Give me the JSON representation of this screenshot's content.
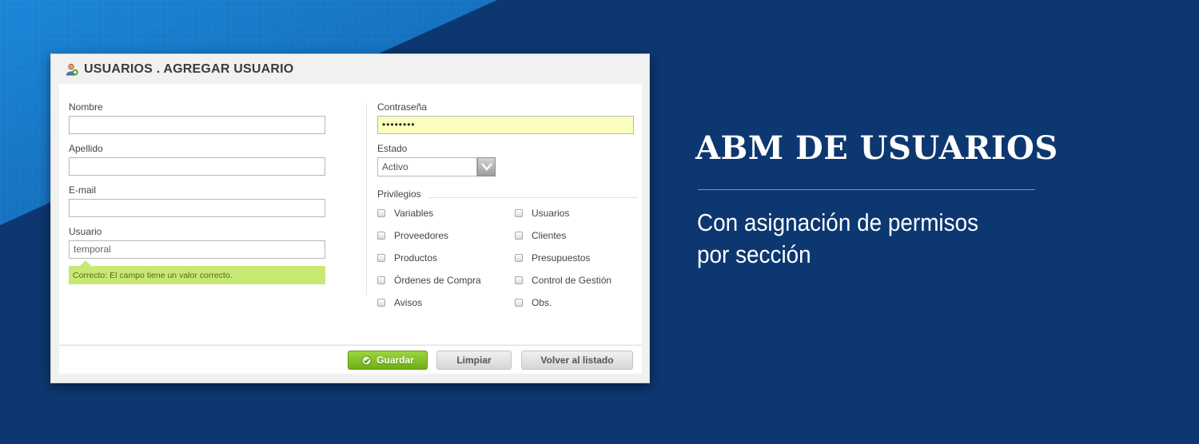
{
  "colors": {
    "background_dark": "#0d3770",
    "background_light": "#1575c8",
    "save_button": "#8cc63f",
    "valid_message": "#c8e874",
    "password_fill": "#fbffbe"
  },
  "panel": {
    "title": "USUARIOS . AGREGAR USUARIO",
    "title_icon": "user-add-icon",
    "fields": {
      "nombre": {
        "label": "Nombre",
        "value": ""
      },
      "apellido": {
        "label": "Apellido",
        "value": ""
      },
      "email": {
        "label": "E-mail",
        "value": ""
      },
      "usuario": {
        "label": "Usuario",
        "value": "temporal"
      },
      "contrasena": {
        "label": "Contraseña",
        "value": "••••••••"
      },
      "estado": {
        "label": "Estado",
        "value": "Activo"
      }
    },
    "validation_message": "Correcto: El campo tiene un valor correcto.",
    "privileges": {
      "label": "Privilegios",
      "left": [
        "Variables",
        "Proveedores",
        "Productos",
        "Órdenes de Compra",
        "Avisos"
      ],
      "right": [
        "Usuarios",
        "Clientes",
        "Presupuestos",
        "Control de Gestión",
        "Obs."
      ]
    },
    "buttons": {
      "save": "Guardar",
      "clear": "Limpiar",
      "back": "Volver al listado"
    }
  },
  "promo": {
    "headline": "ABM DE USUARIOS",
    "subtitle_line1": "Con asignación de permisos",
    "subtitle_line2": "por sección"
  }
}
